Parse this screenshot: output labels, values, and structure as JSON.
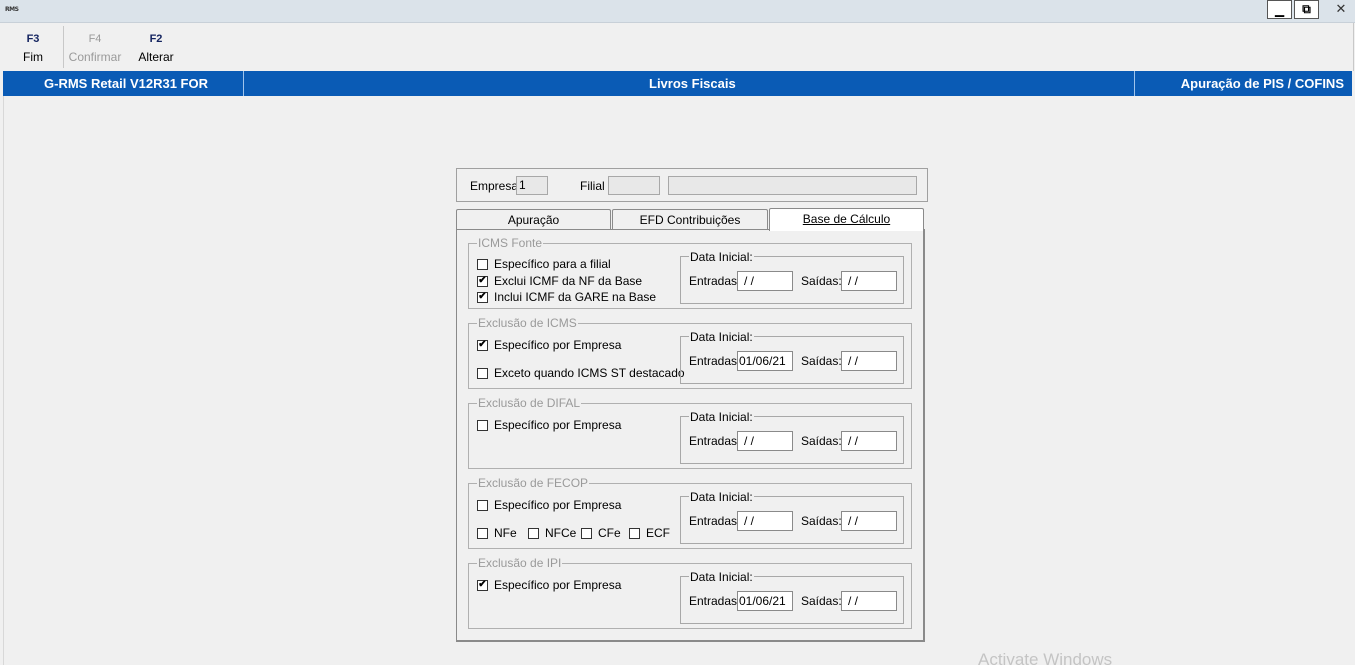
{
  "window": {
    "logo_text": "RMS",
    "minimize_glyph": "▁",
    "maximize_glyph": "⧉",
    "close_glyph": "✕"
  },
  "toolbar": {
    "buttons": [
      {
        "key": "F3",
        "label": "Fim",
        "enabled": true
      },
      {
        "key": "F4",
        "label": "Confirmar",
        "enabled": false
      },
      {
        "key": "F2",
        "label": "Alterar",
        "enabled": true
      }
    ]
  },
  "header": {
    "system": "G-RMS Retail V12R31 FOR",
    "module": "Livros Fiscais",
    "screen": "Apuração de PIS / COFINS"
  },
  "company": {
    "empresa_label": "Empresa",
    "empresa_value": "1",
    "filial_label": "Filial",
    "filial_value": "",
    "filial_name": ""
  },
  "tabs": [
    {
      "label": "Apuração",
      "active": false
    },
    {
      "label": "EFD Contribuições",
      "active": false
    },
    {
      "label": "Base de Cálculo",
      "active": true
    }
  ],
  "sections": {
    "icms_fonte": {
      "title": "ICMS Fonte",
      "checkboxes": [
        {
          "label": "Específico para a filial",
          "checked": false
        },
        {
          "label": "Exclui ICMF da NF da Base",
          "checked": true
        },
        {
          "label": "Inclui ICMF da GARE na Base",
          "checked": true
        }
      ],
      "data_inicial": {
        "title": "Data Inicial:",
        "entradas_label": "Entradas:",
        "entradas": " / /",
        "saidas_label": "Saídas:",
        "saidas": " / /"
      }
    },
    "exclusao_icms": {
      "title": "Exclusão de ICMS",
      "checkboxes": [
        {
          "label": "Específico por Empresa",
          "checked": true
        },
        {
          "label": "Exceto quando ICMS ST destacado",
          "checked": false
        }
      ],
      "data_inicial": {
        "title": "Data Inicial:",
        "entradas_label": "Entradas:",
        "entradas": "01/06/21",
        "saidas_label": "Saídas:",
        "saidas": " / /"
      }
    },
    "exclusao_difal": {
      "title": "Exclusão de DIFAL",
      "checkboxes": [
        {
          "label": "Específico por Empresa",
          "checked": false
        }
      ],
      "data_inicial": {
        "title": "Data Inicial:",
        "entradas_label": "Entradas:",
        "entradas": " / /",
        "saidas_label": "Saídas:",
        "saidas": " / /"
      }
    },
    "exclusao_fecop": {
      "title": "Exclusão de FECOP",
      "checkboxes": [
        {
          "label": "Específico por Empresa",
          "checked": false
        },
        {
          "label": "NFe",
          "checked": false
        },
        {
          "label": "NFCe",
          "checked": false
        },
        {
          "label": "CFe",
          "checked": false
        },
        {
          "label": "ECF",
          "checked": false
        }
      ],
      "data_inicial": {
        "title": "Data Inicial:",
        "entradas_label": "Entradas:",
        "entradas": " / /",
        "saidas_label": "Saídas:",
        "saidas": " / /"
      }
    },
    "exclusao_ipi": {
      "title": "Exclusão de IPI",
      "checkboxes": [
        {
          "label": "Específico por Empresa",
          "checked": true
        }
      ],
      "data_inicial": {
        "title": "Data Inicial:",
        "entradas_label": "Entradas:",
        "entradas": "01/06/21",
        "saidas_label": "Saídas:",
        "saidas": " / /"
      }
    }
  },
  "watermark": "Activate Windows",
  "check_glyph": "✔"
}
